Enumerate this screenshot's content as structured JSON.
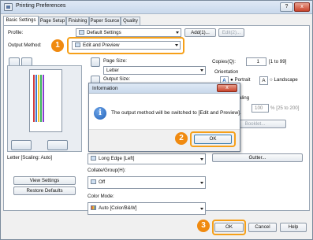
{
  "window": {
    "title": "Printing Preferences",
    "help_glyph": "?",
    "close_glyph": "x"
  },
  "tabs": [
    "Basic Settings",
    "Page Setup",
    "Finishing",
    "Paper Source",
    "Quality"
  ],
  "profile": {
    "label": "Profile:",
    "value": "Default Settings",
    "add_button": "Add(1)...",
    "edit_button": "Edit(2)..."
  },
  "output_method": {
    "label": "Output Method:",
    "value": "Edit and Preview"
  },
  "page_size": {
    "label": "Page Size:",
    "value": "Letter"
  },
  "output_size": {
    "label": "Output Size:"
  },
  "copies": {
    "label": "Copies(Q):",
    "value": "1",
    "range": "[1 to 99]"
  },
  "orientation": {
    "label": "Orientation",
    "portrait": "Portrait",
    "landscape": "Landscape",
    "portrait_glyph": "A",
    "landscape_glyph": "A"
  },
  "scaling": {
    "label": "caling",
    "value": "100",
    "range": "% [25 to 200]"
  },
  "booklet_button": "Booklet...",
  "gutter_button": "Gutter...",
  "binding": {
    "value": "Long Edge [Left]"
  },
  "collate": {
    "label": "Collate/Group(H):",
    "value": "Off"
  },
  "color_mode": {
    "label": "Color Mode:",
    "value": "Auto [Color/B&W]"
  },
  "preview_caption": "Letter [Scaling: Auto]",
  "view_settings_button": "View Settings",
  "restore_defaults_button": "Restore Defaults",
  "dialog": {
    "title": "Information",
    "message": "The output method will be switched to [Edit and Preview].",
    "ok_button": "OK",
    "close_glyph": "x",
    "info_glyph": "i"
  },
  "bottom": {
    "ok_button": "OK",
    "cancel_button": "Cancel",
    "help_button": "Help"
  },
  "callouts": {
    "one": "1",
    "two": "2",
    "three": "3"
  },
  "colors": {
    "callout": "#f08a10",
    "highlight": "#f6a019",
    "accent": "#1e5fb8"
  }
}
